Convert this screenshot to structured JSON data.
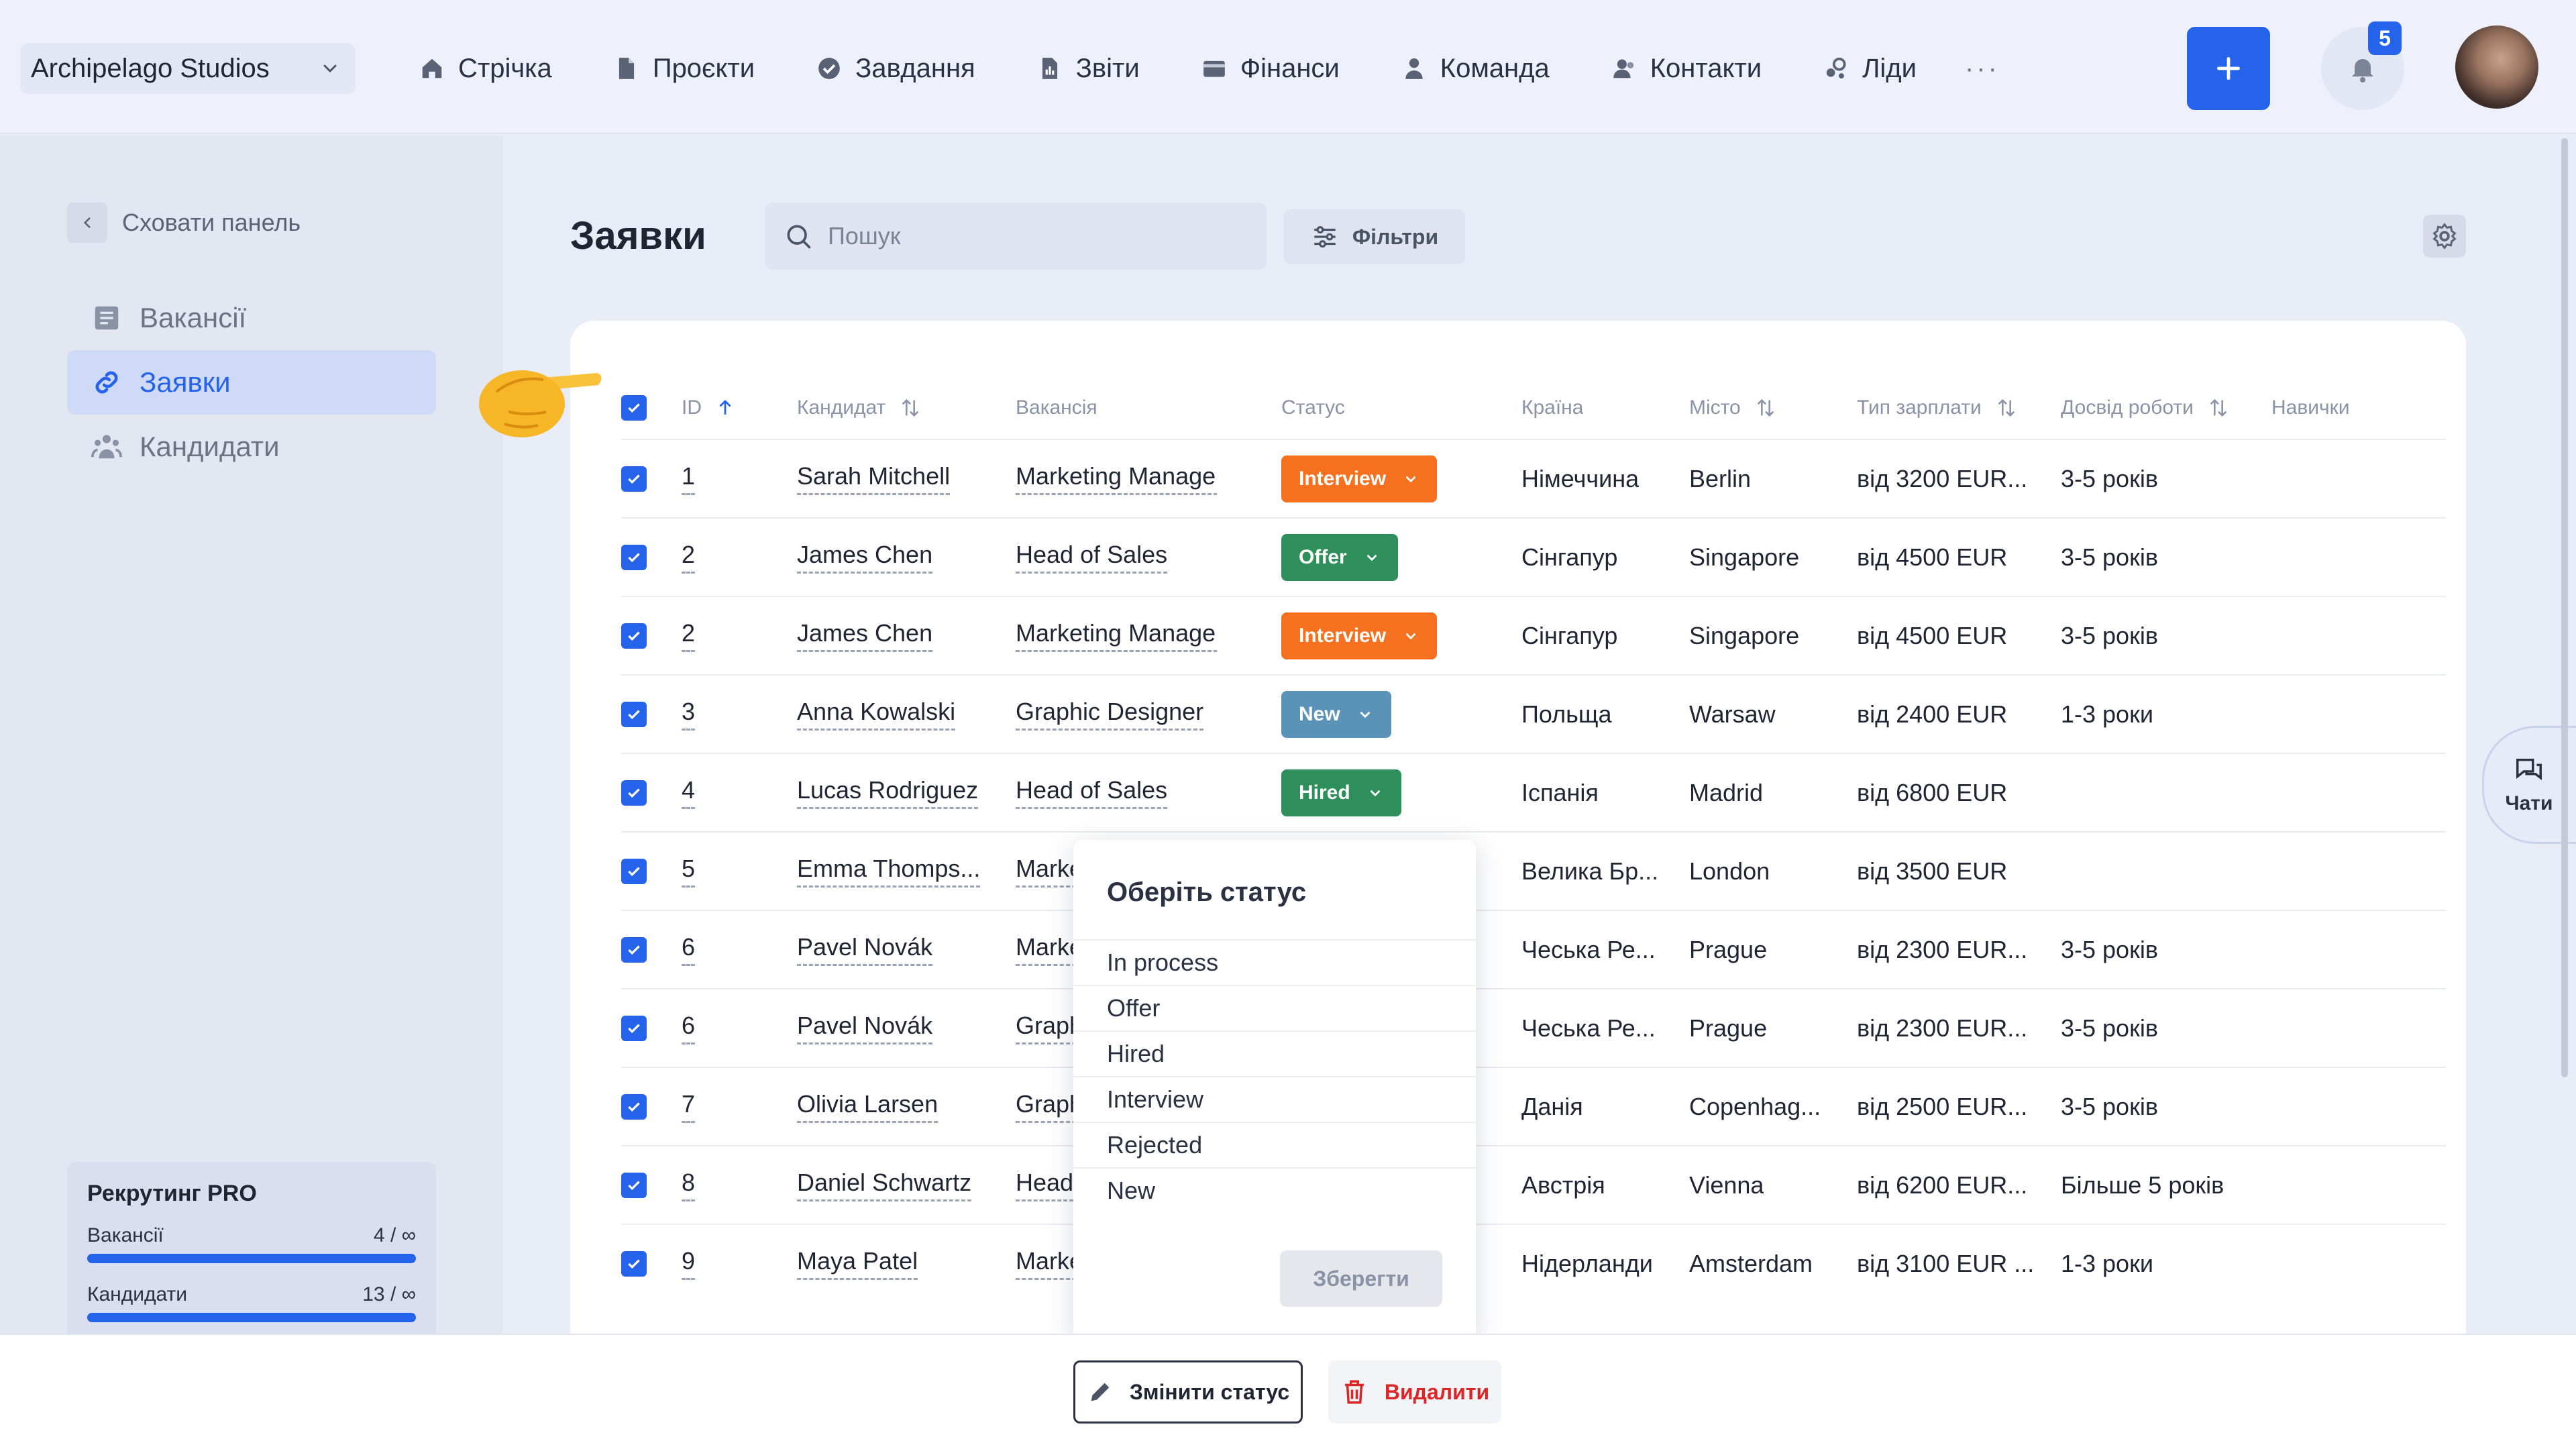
{
  "workspace": {
    "name": "Archipelago Studios",
    "chevron_icon": "chevron-down-icon"
  },
  "nav": {
    "items": [
      {
        "label": "Стрічка",
        "icon": "home-icon"
      },
      {
        "label": "Проєкти",
        "icon": "document-icon"
      },
      {
        "label": "Завдання",
        "icon": "check-circle-icon"
      },
      {
        "label": "Звіти",
        "icon": "report-icon"
      },
      {
        "label": "Фінанси",
        "icon": "wallet-icon"
      },
      {
        "label": "Команда",
        "icon": "user-icon"
      },
      {
        "label": "Контакти",
        "icon": "contacts-icon"
      },
      {
        "label": "Ліди",
        "icon": "leads-icon"
      }
    ],
    "more": "···",
    "add_icon": "plus-icon",
    "notifications_count": "5"
  },
  "sidebar": {
    "hide_label": "Сховати панель",
    "items": [
      {
        "label": "Вакансії",
        "icon": "list-icon",
        "active": false
      },
      {
        "label": "Заявки",
        "icon": "link-icon",
        "active": true
      },
      {
        "label": "Кандидати",
        "icon": "users-icon",
        "active": false
      }
    ],
    "plan": {
      "title": "Рекрутинг PRO",
      "rows": [
        {
          "label": "Вакансії",
          "value": "4 / ∞",
          "fill": 1.0
        },
        {
          "label": "Кандидати",
          "value": "13 / ∞",
          "fill": 1.0
        }
      ]
    }
  },
  "main": {
    "title": "Заявки",
    "search_placeholder": "Пошук",
    "filters_label": "Фільтри"
  },
  "table": {
    "columns": {
      "id": "ID",
      "candidate": "Кандидат",
      "vacancy": "Вакансія",
      "status": "Статус",
      "country": "Країна",
      "city": "Місто",
      "salary": "Тип зарплати",
      "experience": "Досвід роботи",
      "skills": "Навички"
    },
    "rows": [
      {
        "id": "1",
        "candidate": "Sarah Mitchell",
        "vacancy": "Marketing Manager",
        "status": "Interview",
        "status_color": "#f5701f",
        "country": "Німеччина",
        "city": "Berlin",
        "salary": "від 3200 EUR...",
        "experience": "3-5 років"
      },
      {
        "id": "2",
        "candidate": "James Chen",
        "vacancy": "Head of Sales",
        "status": "Offer",
        "status_color": "#2f8f5b",
        "country": "Сінгапур",
        "city": "Singapore",
        "salary": "від 4500 EUR",
        "experience": "3-5 років"
      },
      {
        "id": "2",
        "candidate": "James Chen",
        "vacancy": "Marketing Manager",
        "status": "Interview",
        "status_color": "#f5701f",
        "country": "Сінгапур",
        "city": "Singapore",
        "salary": "від 4500 EUR",
        "experience": "3-5 років"
      },
      {
        "id": "3",
        "candidate": "Anna Kowalski",
        "vacancy": "Graphic Designer",
        "status": "New",
        "status_color": "#5b93b8",
        "country": "Польща",
        "city": "Warsaw",
        "salary": "від 2400 EUR",
        "experience": "1-3 роки"
      },
      {
        "id": "4",
        "candidate": "Lucas Rodriguez",
        "vacancy": "Head of Sales",
        "status": "Hired",
        "status_color": "#2f8f5b",
        "country": "Іспанія",
        "city": "Madrid",
        "salary": "від 6800 EUR",
        "experience": ""
      },
      {
        "id": "5",
        "candidate": "Emma Thomps...",
        "vacancy": "Marke",
        "status": "",
        "status_color": "",
        "country": "Велика Бр...",
        "city": "London",
        "salary": "від 3500 EUR",
        "experience": ""
      },
      {
        "id": "6",
        "candidate": "Pavel Novák",
        "vacancy": "Marke",
        "status": "",
        "status_color": "",
        "country": "Чеська Ре...",
        "city": "Prague",
        "salary": "від 2300 EUR...",
        "experience": "3-5 років"
      },
      {
        "id": "6",
        "candidate": "Pavel Novák",
        "vacancy": "Graph",
        "status": "",
        "status_color": "",
        "country": "Чеська Ре...",
        "city": "Prague",
        "salary": "від 2300 EUR...",
        "experience": "3-5 років"
      },
      {
        "id": "7",
        "candidate": "Olivia Larsen",
        "vacancy": "Graph",
        "status": "",
        "status_color": "",
        "country": "Данія",
        "city": "Copenhag...",
        "salary": "від 2500 EUR...",
        "experience": "3-5 років"
      },
      {
        "id": "8",
        "candidate": "Daniel Schwartz",
        "vacancy": "Head",
        "status": "",
        "status_color": "",
        "country": "Австрія",
        "city": "Vienna",
        "salary": "від 6200 EUR...",
        "experience": "Більше 5 років"
      },
      {
        "id": "9",
        "candidate": "Maya Patel",
        "vacancy": "Marke",
        "status": "",
        "status_color": "",
        "country": "Нідерланди",
        "city": "Amsterdam",
        "salary": "від 3100 EUR ...",
        "experience": "1-3 роки"
      }
    ]
  },
  "status_popover": {
    "title": "Оберіть статус",
    "options": [
      "In process",
      "Offer",
      "Hired",
      "Interview",
      "Rejected",
      "New"
    ],
    "save_label": "Зберегти"
  },
  "bulk_actions": {
    "change_status_label": "Змінити статус",
    "delete_label": "Видалити"
  },
  "chat_tab": {
    "label": "Чати"
  }
}
